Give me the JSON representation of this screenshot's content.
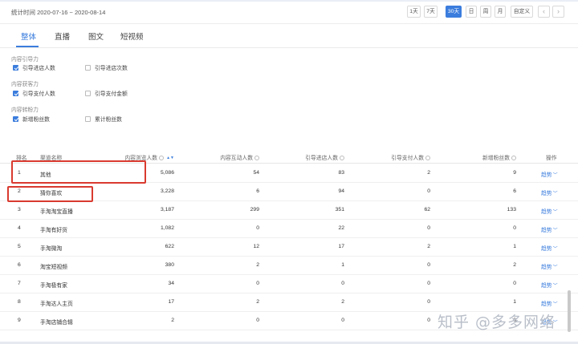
{
  "header": {
    "stat_time": "统计时间 2020-07-16 ~ 2020-08-14",
    "ranges": [
      {
        "label": "1天",
        "active": false
      },
      {
        "label": "7天",
        "active": false
      },
      {
        "label": "30天",
        "active": true
      },
      {
        "label": "日",
        "active": false
      },
      {
        "label": "周",
        "active": false
      },
      {
        "label": "月",
        "active": false
      },
      {
        "label": "自定义",
        "active": false
      }
    ],
    "prev_icon": "chevron-left-icon",
    "next_icon": "chevron-right-icon"
  },
  "tabs": [
    {
      "label": "整体",
      "active": true
    },
    {
      "label": "直播",
      "active": false
    },
    {
      "label": "图文",
      "active": false
    },
    {
      "label": "短视频",
      "active": false
    }
  ],
  "filters": [
    {
      "title": "内容引导力",
      "options": [
        {
          "label": "引导进店人数",
          "checked": true
        },
        {
          "label": "引导进店次数",
          "checked": false
        }
      ]
    },
    {
      "title": "内容获客力",
      "options": [
        {
          "label": "引导支付人数",
          "checked": true
        },
        {
          "label": "引导支付金额",
          "checked": false
        }
      ]
    },
    {
      "title": "内容转粉力",
      "options": [
        {
          "label": "新增粉丝数",
          "checked": true
        },
        {
          "label": "累计粉丝数",
          "checked": false
        }
      ]
    }
  ],
  "table": {
    "columns": [
      "排名",
      "渠道名称",
      "内容浏览人数",
      "内容互动人数",
      "引导进店人数",
      "引导支付人数",
      "新增粉丝数",
      "操作"
    ],
    "trend_label": "趋势",
    "rows": [
      [
        "1",
        "其他",
        "5,086",
        "54",
        "83",
        "2",
        "9"
      ],
      [
        "2",
        "猜你喜欢",
        "3,228",
        "6",
        "94",
        "0",
        "6"
      ],
      [
        "3",
        "手淘淘宝直播",
        "3,187",
        "299",
        "351",
        "62",
        "133"
      ],
      [
        "4",
        "手淘有好货",
        "1,082",
        "0",
        "22",
        "0",
        "0"
      ],
      [
        "5",
        "手淘微淘",
        "622",
        "12",
        "17",
        "2",
        "1"
      ],
      [
        "6",
        "淘宝短视频",
        "380",
        "2",
        "1",
        "0",
        "2"
      ],
      [
        "7",
        "手淘极有家",
        "34",
        "0",
        "0",
        "0",
        "0"
      ],
      [
        "8",
        "手淘达人主页",
        "17",
        "2",
        "2",
        "0",
        "1"
      ],
      [
        "9",
        "手淘店铺合辑",
        "2",
        "0",
        "0",
        "0",
        "0"
      ]
    ]
  },
  "watermark": "知乎 @多多网络",
  "colors": {
    "accent": "#3b7ddd",
    "highlight": "#d93a2f"
  }
}
